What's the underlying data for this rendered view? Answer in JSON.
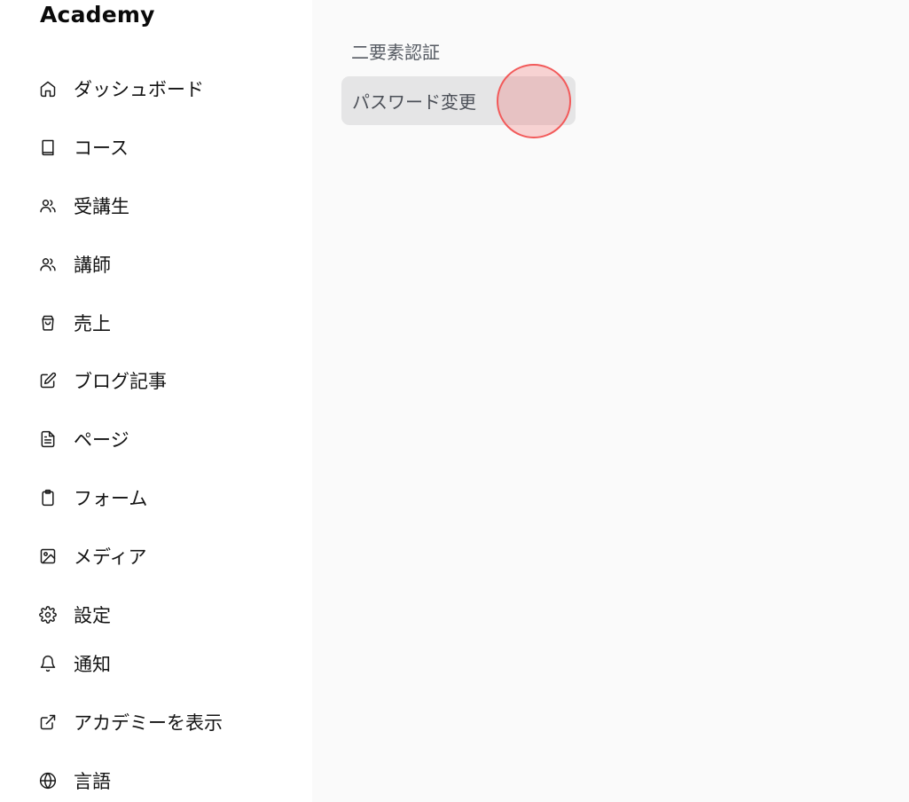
{
  "brand": "Academy",
  "sidebar": {
    "items": [
      {
        "label": "ダッシュボード",
        "icon": "home-icon"
      },
      {
        "label": "コース",
        "icon": "book-icon"
      },
      {
        "label": "受講生",
        "icon": "users-icon"
      },
      {
        "label": "講師",
        "icon": "users-icon"
      },
      {
        "label": "売上",
        "icon": "shopping-bag-icon"
      },
      {
        "label": "ブログ記事",
        "icon": "edit-icon"
      },
      {
        "label": "ページ",
        "icon": "file-text-icon"
      },
      {
        "label": "フォーム",
        "icon": "clipboard-icon"
      },
      {
        "label": "メディア",
        "icon": "image-icon"
      },
      {
        "label": "設定",
        "icon": "gear-icon"
      },
      {
        "label": "通知",
        "icon": "bell-icon"
      },
      {
        "label": "アカデミーを表示",
        "icon": "external-link-icon"
      },
      {
        "label": "言語",
        "icon": "globe-icon"
      }
    ]
  },
  "settings_nav": {
    "two_factor_label": "二要素認証",
    "change_password_label": "パスワード変更"
  },
  "colors": {
    "active_bg": "#e5e5e6",
    "click_marker": "#f25a5a"
  }
}
